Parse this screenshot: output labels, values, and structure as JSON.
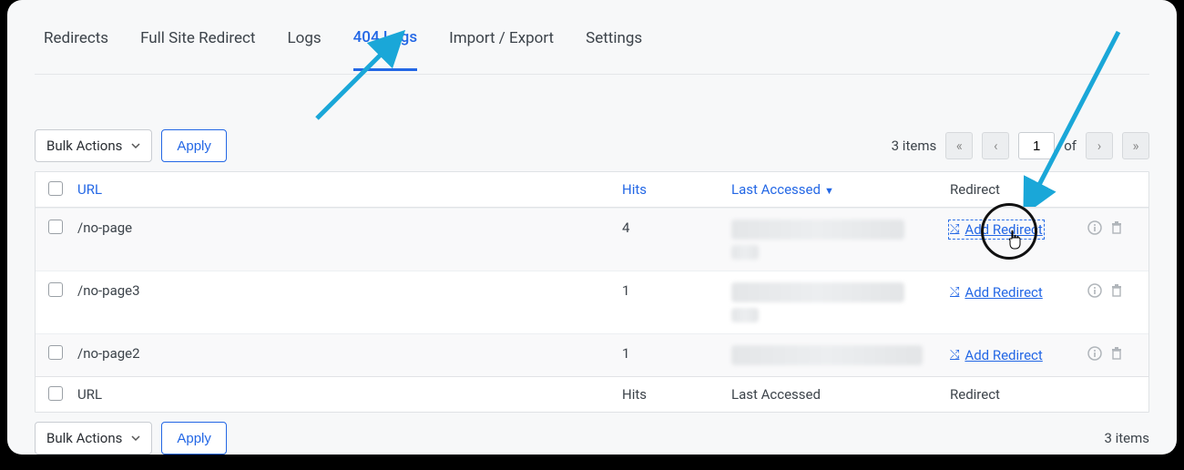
{
  "tabs": {
    "redirects": "Redirects",
    "full_site": "Full Site Redirect",
    "logs": "Logs",
    "logs404": "404 Logs",
    "import_export": "Import / Export",
    "settings": "Settings"
  },
  "toolbar": {
    "bulk_label": "Bulk Actions",
    "apply_label": "Apply",
    "items_count": "3 items",
    "page_current": "1",
    "of_label": "of"
  },
  "columns": {
    "url": "URL",
    "hits": "Hits",
    "last": "Last Accessed",
    "redirect": "Redirect"
  },
  "rows": [
    {
      "url": "/no-page",
      "hits": "4",
      "add": "Add Redirect"
    },
    {
      "url": "/no-page3",
      "hits": "1",
      "add": "Add Redirect"
    },
    {
      "url": "/no-page2",
      "hits": "1",
      "add": "Add Redirect"
    }
  ],
  "footer": {
    "items_count": "3 items"
  }
}
